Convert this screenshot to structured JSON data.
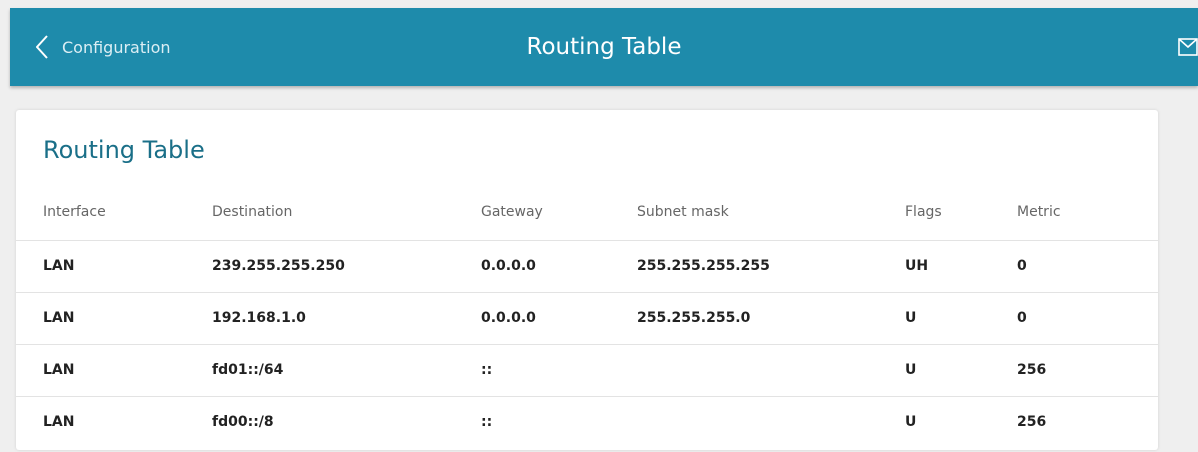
{
  "header": {
    "back_label": "Configuration",
    "title": "Routing Table",
    "background_color": "#1e8bab",
    "back_icon": "chevron-left-icon",
    "mail_icon": "mail-icon"
  },
  "card": {
    "title": "Routing Table",
    "columns": [
      "Interface",
      "Destination",
      "Gateway",
      "Subnet mask",
      "Flags",
      "Metric"
    ],
    "rows": [
      [
        "LAN",
        "239.255.255.250",
        "0.0.0.0",
        "255.255.255.255",
        "UH",
        "0"
      ],
      [
        "LAN",
        "192.168.1.0",
        "0.0.0.0",
        "255.255.255.0",
        "U",
        "0"
      ],
      [
        "LAN",
        "fd01::/64",
        "::",
        "",
        "U",
        "256"
      ],
      [
        "LAN",
        "fd00::/8",
        "::",
        "",
        "U",
        "256"
      ]
    ]
  }
}
